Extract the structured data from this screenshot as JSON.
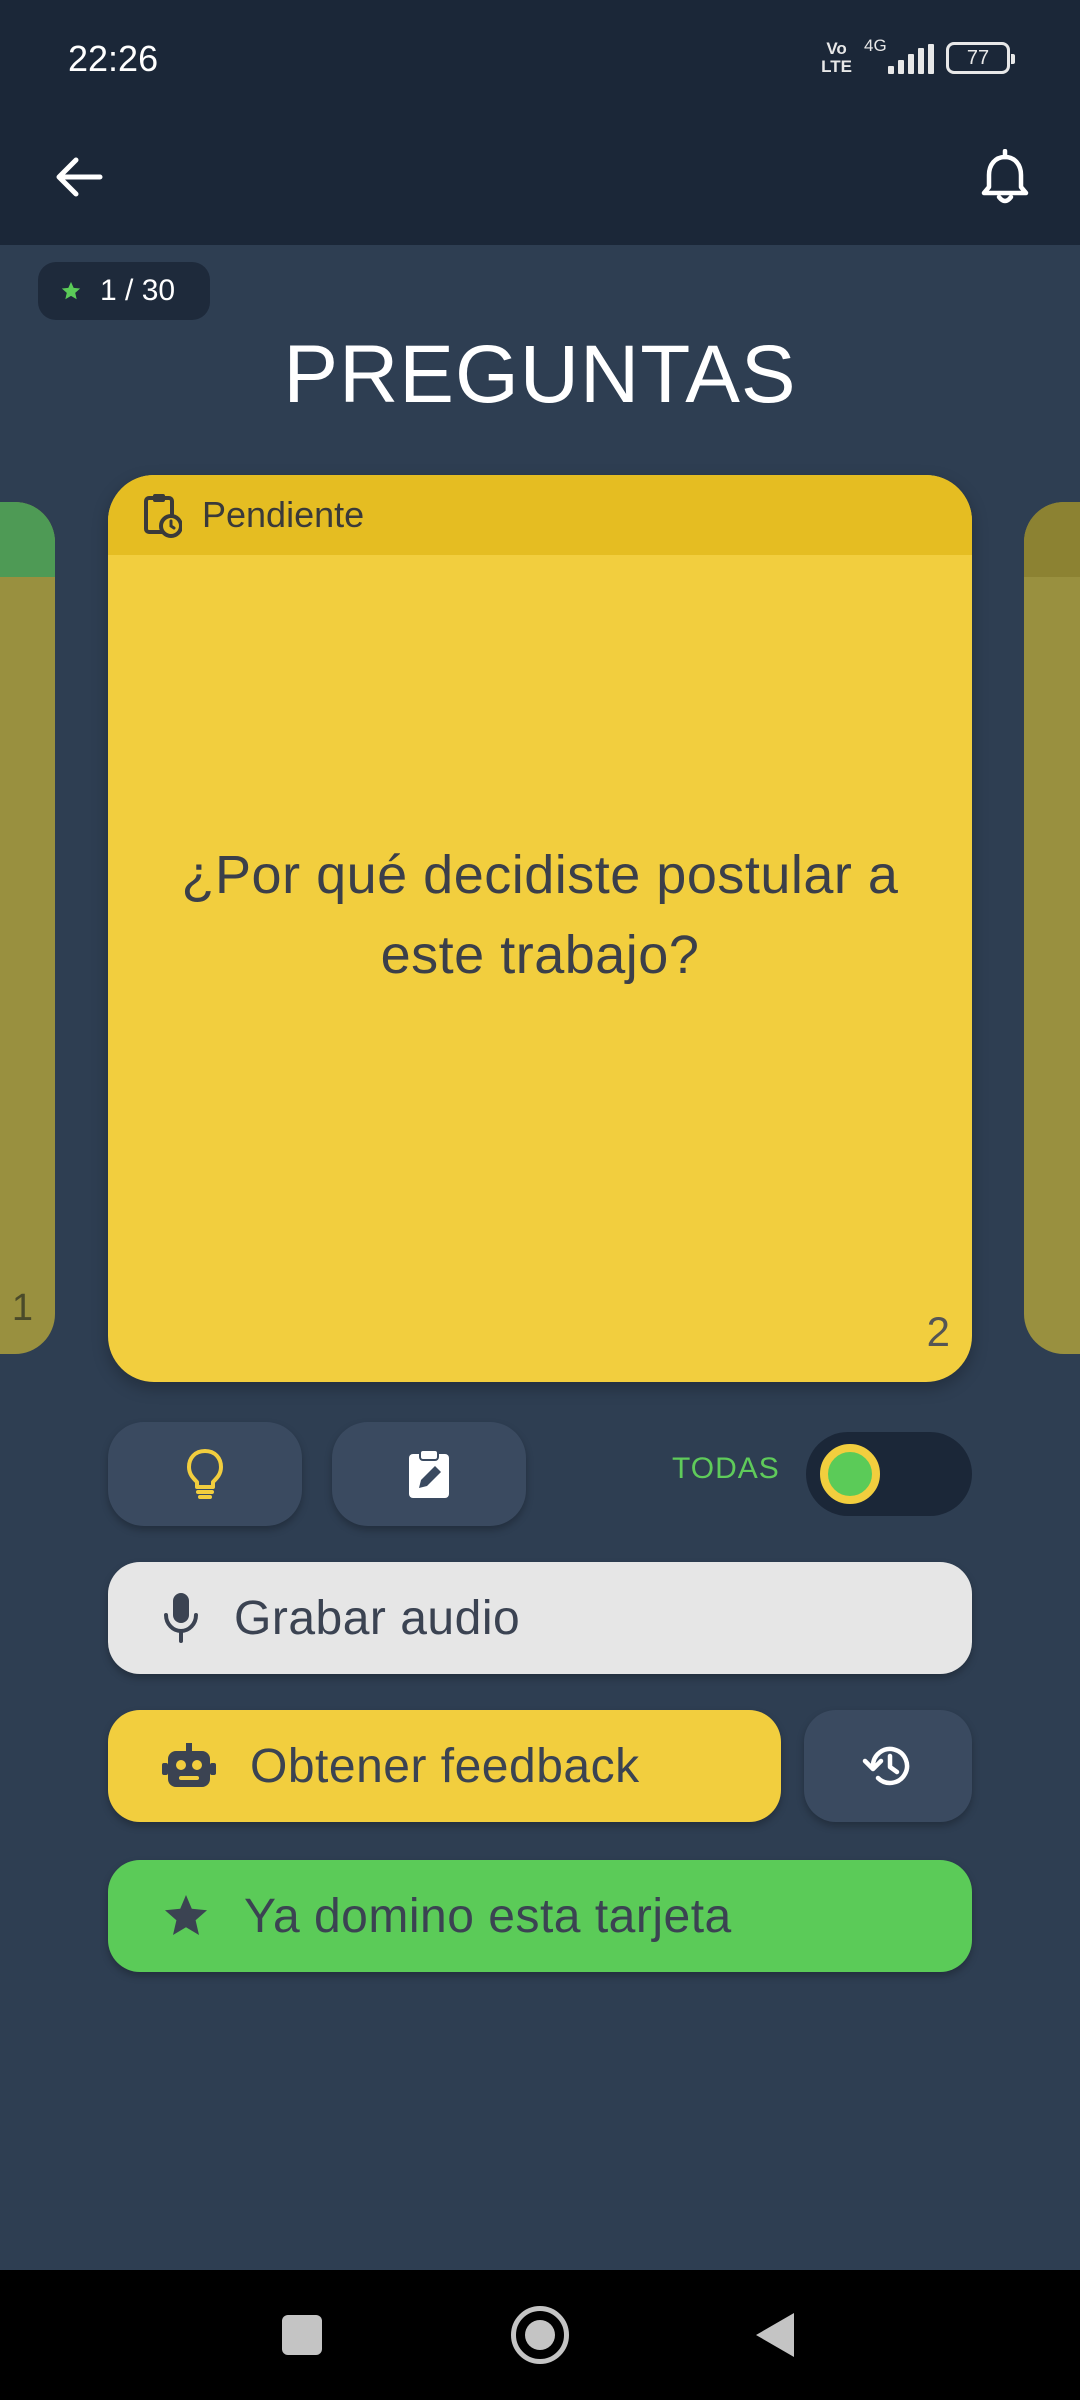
{
  "status_bar": {
    "time": "22:26",
    "volte_top": "Vo",
    "volte_bottom": "LTE",
    "network": "4G",
    "battery": "77"
  },
  "header": {
    "back_icon": "arrow-left-icon",
    "notifications_icon": "bell-icon"
  },
  "progress": {
    "star_icon": "star-icon",
    "text": "1 / 30"
  },
  "page": {
    "title": "PREGUNTAS"
  },
  "cards": {
    "previous_number": "1",
    "current": {
      "status_icon": "clipboard-clock-icon",
      "status": "Pendiente",
      "question": "¿Por qué decidiste postular a este trabajo?",
      "number": "2"
    }
  },
  "tools": {
    "hint_icon": "lightbulb-icon",
    "notes_icon": "clipboard-edit-icon",
    "filter_label": "TODAS",
    "filter_toggle_on": false
  },
  "actions": {
    "record_label": "Grabar audio",
    "record_icon": "microphone-icon",
    "feedback_label": "Obtener feedback",
    "feedback_icon": "robot-icon",
    "history_icon": "history-icon",
    "mastered_label": "Ya domino esta tarjeta",
    "mastered_icon": "star-icon"
  },
  "colors": {
    "background": "#2e3e52",
    "app_bar": "#1b2738",
    "card_yellow": "#f2ce3e",
    "card_header_yellow": "#e5bd22",
    "accent_green": "#5bcb58",
    "button_dark": "#3a4a60"
  }
}
